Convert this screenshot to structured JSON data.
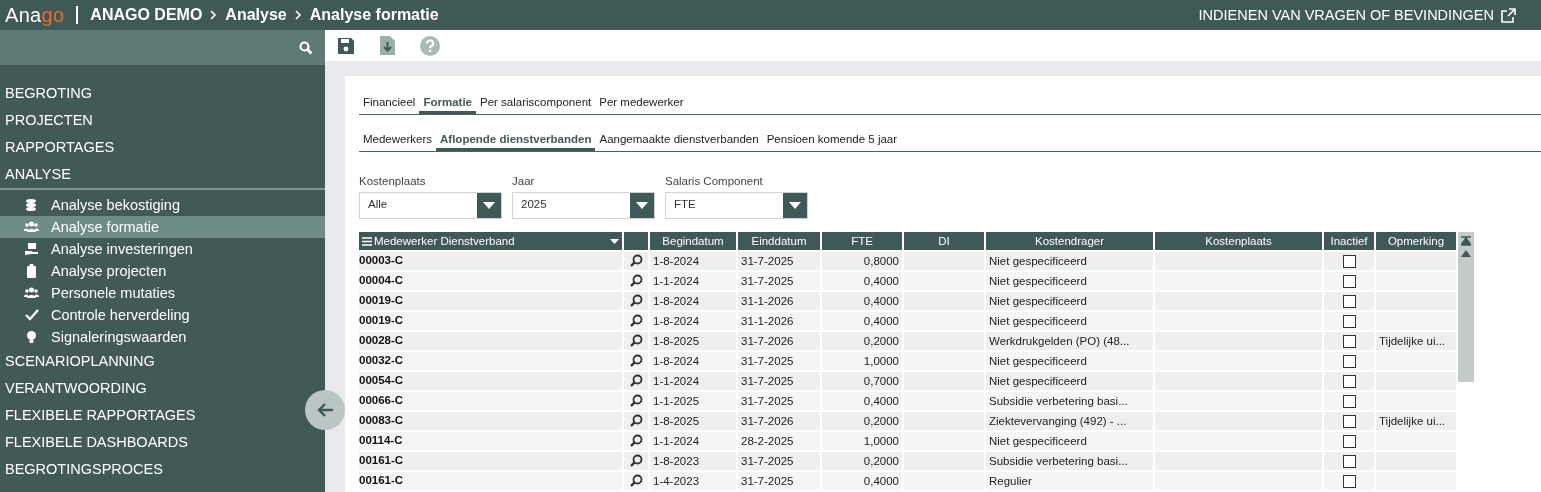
{
  "header": {
    "logo": {
      "text": "Ana",
      "accent": "go"
    },
    "breadcrumb": [
      "ANAGO DEMO",
      "Analyse",
      "Analyse formatie"
    ],
    "feedback_link": "INDIENEN VAN VRAGEN OF BEVINDINGEN"
  },
  "sidebar": {
    "items": [
      {
        "label": "BEGROTING",
        "expanded": false
      },
      {
        "label": "PROJECTEN",
        "expanded": false
      },
      {
        "label": "RAPPORTAGES",
        "expanded": false
      },
      {
        "label": "ANALYSE",
        "expanded": true,
        "children": [
          {
            "label": "Analyse bekostiging",
            "selected": false
          },
          {
            "label": "Analyse formatie",
            "selected": true
          },
          {
            "label": "Analyse investeringen",
            "selected": false
          },
          {
            "label": "Analyse projecten",
            "selected": false
          },
          {
            "label": "Personele mutaties",
            "selected": false
          },
          {
            "label": "Controle herverdeling",
            "selected": false
          },
          {
            "label": "Signaleringswaarden",
            "selected": false
          }
        ]
      },
      {
        "label": "SCENARIOPLANNING",
        "expanded": false
      },
      {
        "label": "VERANTWOORDING",
        "expanded": false
      },
      {
        "label": "FLEXIBELE RAPPORTAGES",
        "expanded": false
      },
      {
        "label": "FLEXIBELE DASHBOARDS",
        "expanded": false
      },
      {
        "label": "BEGROTINGSPROCES",
        "expanded": false
      }
    ]
  },
  "tabs": [
    {
      "label": "Financieel",
      "selected": false
    },
    {
      "label": "Formatie",
      "selected": true
    },
    {
      "label": "Per salariscomponent",
      "selected": false
    },
    {
      "label": "Per medewerker",
      "selected": false
    }
  ],
  "subtabs": [
    {
      "label": "Medewerkers",
      "selected": false
    },
    {
      "label": "Aflopende dienstverbanden",
      "selected": true
    },
    {
      "label": "Aangemaakte dienstverbanden",
      "selected": false
    },
    {
      "label": "Pensioen komende 5 jaar",
      "selected": false
    }
  ],
  "filters": [
    {
      "label": "Kostenplaats",
      "value": "Alle"
    },
    {
      "label": "Jaar",
      "value": "2025"
    },
    {
      "label": "Salaris Component",
      "value": "FTE"
    }
  ],
  "table": {
    "columns": [
      "Medewerker Dienstverband",
      "Begindatum",
      "Einddatum",
      "FTE",
      "DI",
      "Kostendrager",
      "Kostenplaats",
      "Inactief",
      "Opmerking"
    ],
    "rows": [
      {
        "code": "00003-C",
        "begin": "1-8-2024",
        "end": "31-7-2025",
        "fte": "0,8000",
        "kostendrager": "Niet gespecificeerd",
        "inactive": false,
        "remark": ""
      },
      {
        "code": "00004-C",
        "begin": "1-1-2024",
        "end": "31-7-2025",
        "fte": "0,4000",
        "kostendrager": "Niet gespecificeerd",
        "inactive": false,
        "remark": ""
      },
      {
        "code": "00019-C",
        "begin": "1-8-2024",
        "end": "31-1-2026",
        "fte": "0,4000",
        "kostendrager": "Niet gespecificeerd",
        "inactive": false,
        "remark": ""
      },
      {
        "code": "00019-C",
        "begin": "1-8-2024",
        "end": "31-1-2026",
        "fte": "0,4000",
        "kostendrager": "Niet gespecificeerd",
        "inactive": false,
        "remark": ""
      },
      {
        "code": "00028-C",
        "begin": "1-8-2025",
        "end": "31-7-2026",
        "fte": "0,2000",
        "kostendrager": "Werkdrukgelden (PO) (48...",
        "inactive": false,
        "remark": "Tijdelijke ui..."
      },
      {
        "code": "00032-C",
        "begin": "1-8-2024",
        "end": "31-7-2025",
        "fte": "1,0000",
        "kostendrager": "Niet gespecificeerd",
        "inactive": false,
        "remark": ""
      },
      {
        "code": "00054-C",
        "begin": "1-1-2024",
        "end": "31-7-2025",
        "fte": "0,7000",
        "kostendrager": "Niet gespecificeerd",
        "inactive": false,
        "remark": ""
      },
      {
        "code": "00066-C",
        "begin": "1-1-2025",
        "end": "31-7-2025",
        "fte": "0,4000",
        "kostendrager": "Subsidie verbetering basi...",
        "inactive": false,
        "remark": ""
      },
      {
        "code": "00083-C",
        "begin": "1-8-2025",
        "end": "31-7-2026",
        "fte": "0,2000",
        "kostendrager": "Ziektevervanging (492) - ...",
        "inactive": false,
        "remark": "Tijdelijke ui..."
      },
      {
        "code": "00114-C",
        "begin": "1-1-2024",
        "end": "28-2-2025",
        "fte": "1,0000",
        "kostendrager": "Niet gespecificeerd",
        "inactive": false,
        "remark": ""
      },
      {
        "code": "00161-C",
        "begin": "1-8-2023",
        "end": "31-7-2025",
        "fte": "0,2000",
        "kostendrager": "Subsidie verbetering basi...",
        "inactive": false,
        "remark": ""
      },
      {
        "code": "00161-C",
        "begin": "1-4-2023",
        "end": "31-7-2025",
        "fte": "0,4000",
        "kostendrager": "Regulier",
        "inactive": false,
        "remark": ""
      }
    ]
  }
}
